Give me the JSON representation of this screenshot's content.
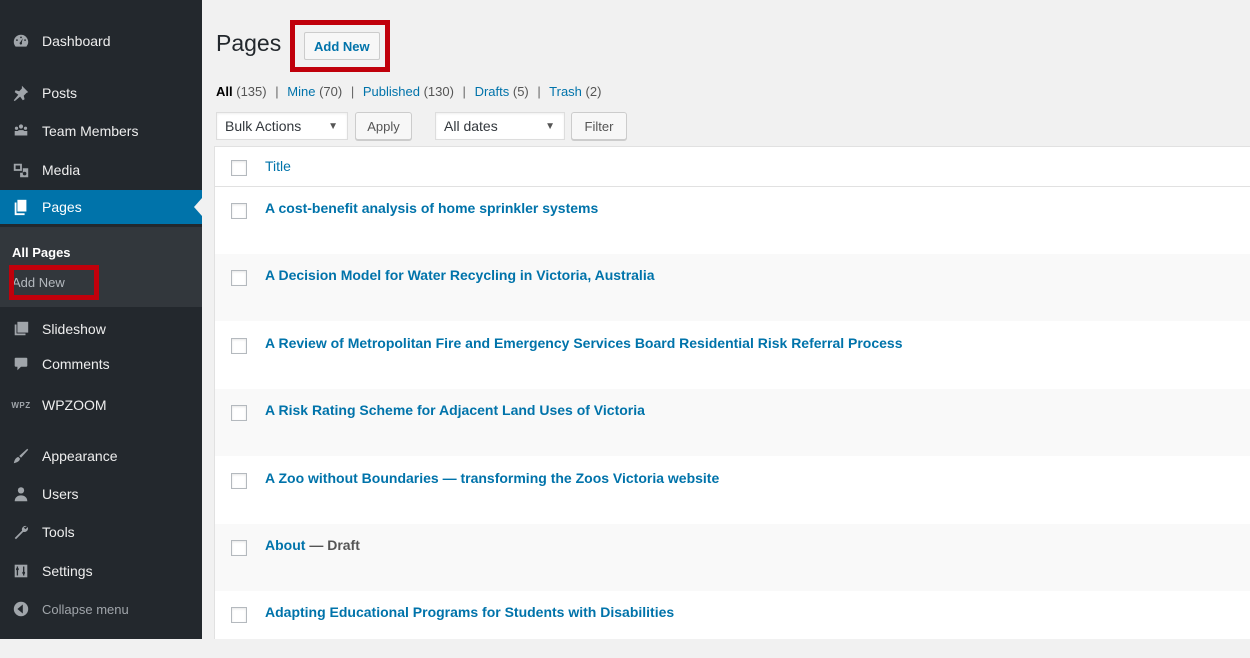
{
  "sidebar": {
    "items": [
      {
        "label": "Dashboard",
        "icon": "dashboard-icon"
      },
      {
        "label": "Posts",
        "icon": "pushpin-icon"
      },
      {
        "label": "Team Members",
        "icon": "group-icon"
      },
      {
        "label": "Media",
        "icon": "media-icon"
      },
      {
        "label": "Pages",
        "icon": "pages-icon"
      },
      {
        "label": "Slideshow",
        "icon": "slideshow-icon"
      },
      {
        "label": "Comments",
        "icon": "comment-icon"
      },
      {
        "label": "WPZOOM",
        "icon": "wpzoom-logo"
      },
      {
        "label": "Appearance",
        "icon": "brush-icon"
      },
      {
        "label": "Users",
        "icon": "users-icon"
      },
      {
        "label": "Tools",
        "icon": "wrench-icon"
      },
      {
        "label": "Settings",
        "icon": "settings-icon"
      }
    ],
    "active": "Pages",
    "submenu": {
      "all_pages": "All Pages",
      "add_new": "Add New"
    },
    "wpzoom_logo_text": "WPZ",
    "collapse": "Collapse menu"
  },
  "header": {
    "title": "Pages",
    "add_new": "Add New"
  },
  "filters": {
    "all": "All",
    "all_count": "(135)",
    "mine": "Mine",
    "mine_count": "(70)",
    "published": "Published",
    "published_count": "(130)",
    "drafts": "Drafts",
    "drafts_count": "(5)",
    "trash": "Trash",
    "trash_count": "(2)",
    "separator": "|"
  },
  "actions": {
    "bulk": "Bulk Actions",
    "apply": "Apply",
    "dates": "All dates",
    "filter": "Filter",
    "caret": "▼"
  },
  "table": {
    "column_title": "Title",
    "rows": [
      {
        "title": "A cost-benefit analysis of home sprinkler systems",
        "state": ""
      },
      {
        "title": "A Decision Model for Water Recycling in Victoria, Australia",
        "state": ""
      },
      {
        "title": "A Review of Metropolitan Fire and Emergency Services Board Residential Risk Referral Process",
        "state": ""
      },
      {
        "title": "A Risk Rating Scheme for Adjacent Land Uses of Victoria",
        "state": ""
      },
      {
        "title": "A Zoo without Boundaries — transforming the Zoos Victoria website",
        "state": ""
      },
      {
        "title": "About",
        "state": " — Draft"
      },
      {
        "title": "Adapting Educational Programs for Students with Disabilities",
        "state": ""
      }
    ]
  },
  "colors": {
    "sidebar_bg": "#23282d",
    "active_bg": "#0073aa",
    "link": "#0073aa",
    "highlight": "#c0000b"
  }
}
